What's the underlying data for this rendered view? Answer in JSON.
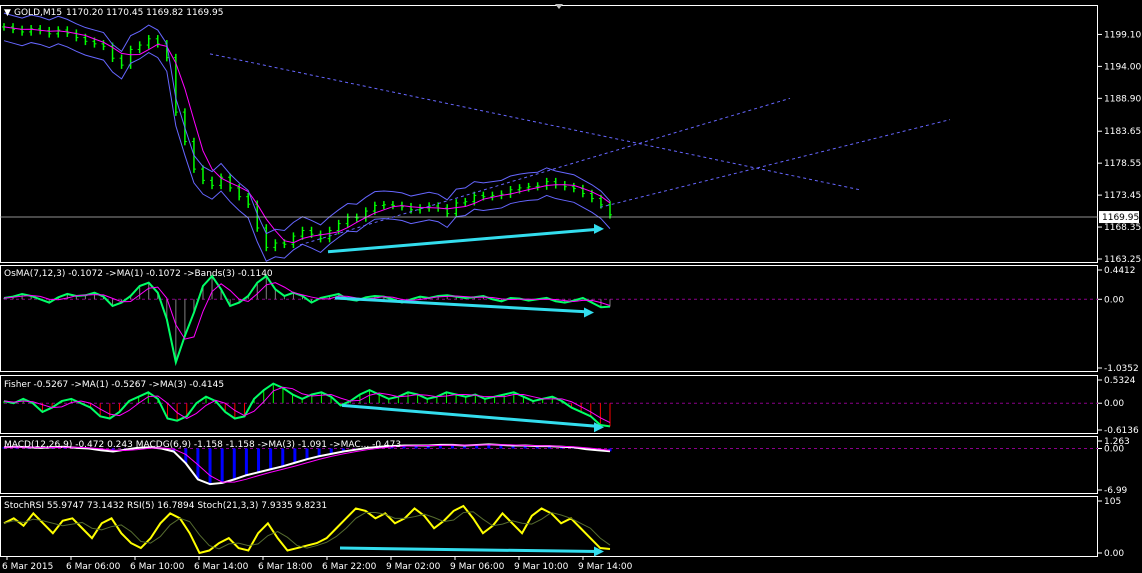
{
  "window": {
    "symbol_title": "GOLD,M15",
    "ohlc": "1170.20 1170.45 1169.82 1169.95"
  },
  "colors": {
    "background": "#000000",
    "grid": "#FFFFFF",
    "bull_bar": "#00FF00",
    "ma_line": "#FF00FF",
    "bands_line": "#6666FF",
    "trend_line": "#6666FF",
    "arrow": "#33DDEE",
    "price_line": "#C0C0C0",
    "fisher_hist_up": "#00FF00",
    "fisher_hist_down": "#FF0000",
    "macd_hist": "#0000FF",
    "stoch_main": "#FFFF00",
    "stoch_signal": "#556B2F"
  },
  "chart_data": [
    {
      "type": "line",
      "name": "price",
      "title": "GOLD,M15",
      "ylim": [
        1163.25,
        1203.0
      ],
      "y_ticks": [
        "1199.10",
        "1194.00",
        "1188.90",
        "1183.65",
        "1178.55",
        "1173.45",
        "1168.35",
        "1163.25"
      ],
      "current_price": "1169.95",
      "series": [
        {
          "name": "close",
          "values": [
            1200.3,
            1199.9,
            1199.5,
            1200.0,
            1199.7,
            1199.2,
            1199.8,
            1199.3,
            1198.6,
            1198.0,
            1197.6,
            1197.2,
            1195.3,
            1194.2,
            1196.7,
            1197.4,
            1198.4,
            1197.6,
            1195.4,
            1186.7,
            1182.0,
            1177.6,
            1175.8,
            1175.0,
            1176.3,
            1174.6,
            1173.2,
            1172.0,
            1168.2,
            1165.1,
            1165.8,
            1165.6,
            1166.9,
            1167.8,
            1167.2,
            1166.5,
            1167.8,
            1168.9,
            1169.9,
            1169.8,
            1170.9,
            1171.8,
            1171.9,
            1171.8,
            1171.6,
            1171.1,
            1171.4,
            1171.7,
            1171.4,
            1170.5,
            1172.2,
            1172.4,
            1173.4,
            1173.2,
            1173.4,
            1173.6,
            1174.3,
            1174.6,
            1174.8,
            1174.9,
            1175.6,
            1175.1,
            1174.8,
            1174.5,
            1173.7,
            1172.9,
            1171.9,
            1170.3
          ]
        }
      ],
      "x_labels": [
        "6 Mar 2015",
        "6 Mar 06:00",
        "6 Mar 10:00",
        "6 Mar 14:00",
        "6 Mar 18:00",
        "6 Mar 22:00",
        "9 Mar 02:00",
        "9 Mar 06:00",
        "9 Mar 10:00",
        "9 Mar 14:00"
      ]
    },
    {
      "type": "line",
      "name": "osma",
      "title": "OsMA(7,12,3) -0.1072  ->MA(1) -0.1072  ->Bands(3) -0.1140",
      "ylim": [
        -1.0352,
        0.4412
      ],
      "y_ticks": [
        "0.4412",
        "0.00",
        "-1.0352"
      ],
      "series": [
        {
          "name": "",
          "values": [
            0.02,
            0.04,
            0.08,
            0.05,
            0.0,
            -0.05,
            0.03,
            0.08,
            0.05,
            0.06,
            0.1,
            0.04,
            -0.1,
            -0.05,
            0.05,
            0.2,
            0.25,
            0.1,
            -0.3,
            -0.95,
            -0.55,
            -0.2,
            0.2,
            0.35,
            0.15,
            -0.1,
            -0.05,
            0.05,
            0.25,
            0.35,
            0.15,
            0.05,
            0.1,
            0.05,
            -0.05,
            0.02,
            0.05,
            0.08,
            0.0,
            -0.02,
            0.03,
            0.05,
            0.04,
            0.0,
            -0.05,
            0.0,
            0.04,
            0.02,
            0.05,
            0.06,
            0.04,
            0.02,
            0.03,
            0.05,
            0.0,
            -0.03,
            0.02,
            0.01,
            -0.02,
            0.0,
            0.02,
            -0.03,
            -0.05,
            -0.02,
            0.02,
            -0.05,
            -0.12,
            -0.11
          ]
        }
      ]
    },
    {
      "type": "line",
      "name": "fisher",
      "title": "Fisher -0.5267  ->MA(1) -0.5267  ->MA(3) -0.4145",
      "ylim": [
        -0.6136,
        0.5324
      ],
      "y_ticks": [
        "0.5324",
        "0.00",
        "-0.6136"
      ],
      "series": [
        {
          "name": "",
          "values": [
            0.05,
            0.0,
            0.1,
            0.0,
            -0.2,
            -0.1,
            0.05,
            0.1,
            0.0,
            -0.1,
            -0.3,
            -0.35,
            -0.2,
            0.05,
            0.15,
            0.25,
            0.1,
            -0.35,
            -0.4,
            -0.3,
            0.0,
            0.15,
            0.05,
            -0.2,
            -0.35,
            -0.3,
            0.1,
            0.3,
            0.45,
            0.35,
            0.2,
            0.1,
            0.2,
            0.25,
            0.15,
            -0.05,
            0.05,
            0.2,
            0.3,
            0.2,
            0.1,
            0.15,
            0.25,
            0.2,
            0.1,
            0.15,
            0.25,
            0.2,
            0.15,
            0.2,
            0.1,
            0.15,
            0.2,
            0.25,
            0.15,
            0.05,
            0.1,
            0.15,
            0.05,
            -0.1,
            -0.2,
            -0.3,
            -0.5,
            -0.53
          ]
        }
      ]
    },
    {
      "type": "line",
      "name": "macd",
      "title": "MACD(12,26,9) -0.472 0.243  MACDG(6,9) -1.158 -1.158  ->MA(3) -1.091  ->MAC... -0.473",
      "ylim": [
        -6.99,
        1.263
      ],
      "y_ticks": [
        "1.263",
        "0.00",
        "-6.99"
      ],
      "series": [
        {
          "name": "",
          "values": [
            0.2,
            0.3,
            0.2,
            0.1,
            0.2,
            0.3,
            0.1,
            0.0,
            -0.3,
            -0.5,
            -0.2,
            0.1,
            0.2,
            0.0,
            -0.5,
            -2.5,
            -5.2,
            -6.0,
            -5.8,
            -5.2,
            -4.5,
            -4.0,
            -3.5,
            -3.0,
            -2.4,
            -1.8,
            -1.3,
            -0.9,
            -0.5,
            -0.2,
            0.1,
            0.3,
            0.4,
            0.5,
            0.5,
            0.5,
            0.6,
            0.6,
            0.5,
            0.6,
            0.7,
            0.6,
            0.5,
            0.5,
            0.4,
            0.4,
            0.3,
            0.2,
            -0.1,
            -0.3,
            -0.47
          ]
        }
      ]
    },
    {
      "type": "line",
      "name": "stochrsi",
      "title": "StochRSI 55.9747 73.1432  RSI(5) 16.7894  Stoch(21,3,3) 7.9335  9.8231",
      "ylim": [
        0,
        105
      ],
      "y_ticks": [
        "105",
        "0.00"
      ],
      "series": [
        {
          "name": "",
          "values": [
            60,
            70,
            55,
            80,
            60,
            40,
            65,
            70,
            50,
            30,
            60,
            70,
            40,
            20,
            10,
            30,
            60,
            80,
            70,
            40,
            0,
            5,
            20,
            30,
            10,
            5,
            40,
            60,
            30,
            5,
            10,
            15,
            20,
            30,
            50,
            70,
            90,
            85,
            70,
            80,
            60,
            70,
            90,
            75,
            50,
            65,
            85,
            95,
            70,
            40,
            55,
            80,
            60,
            40,
            75,
            90,
            80,
            60,
            70,
            50,
            30,
            10,
            8
          ]
        }
      ]
    }
  ]
}
